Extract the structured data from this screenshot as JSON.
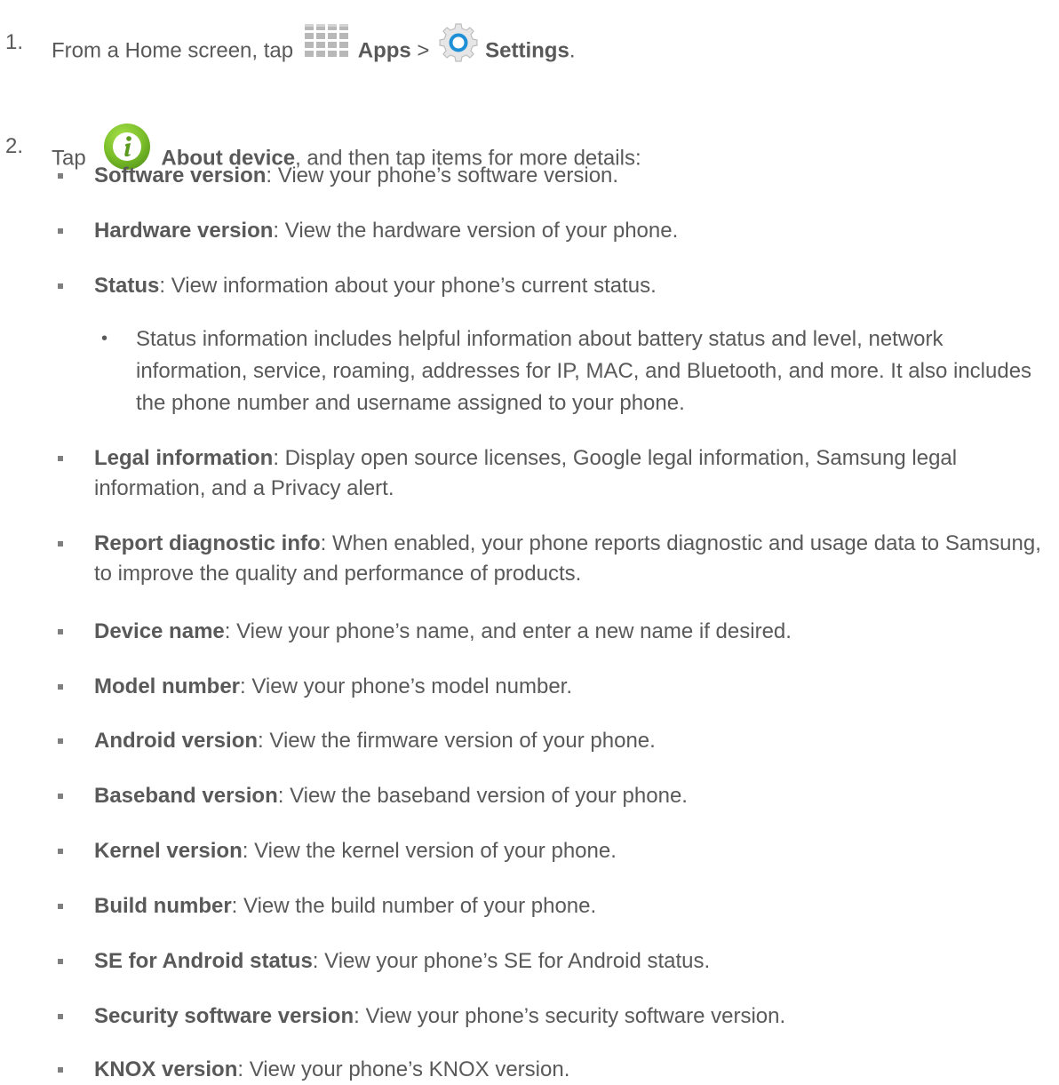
{
  "step1": {
    "number": "1.",
    "text_before": "From a Home screen, tap ",
    "apps_label": "Apps",
    "separator": " > ",
    "settings_label": "Settings",
    "text_after": ".",
    "apps_icon": "apps-grid-icon",
    "settings_icon": "settings-gear-icon"
  },
  "step2": {
    "number": "2.",
    "text_before": "Tap ",
    "about_label": "About device",
    "text_after": ", and then tap items for more details:",
    "about_icon": "info-circle-icon",
    "info_color": "#7bbf2a"
  },
  "items": [
    {
      "label": "Software version",
      "desc": ": View your phone’s software version."
    },
    {
      "label": "Hardware version",
      "desc": ": View the hardware version of your phone."
    },
    {
      "label": "Status",
      "desc": ": View information about your phone’s current status."
    },
    {
      "label": "Legal information",
      "desc": ": Display open source licenses, Google legal information, Samsung legal information, and a Privacy alert."
    },
    {
      "label": "Report diagnostic info",
      "desc": ": When enabled, your phone reports diagnostic and usage data to Samsung, to improve the quality and performance of products."
    },
    {
      "label": "Device name",
      "desc": ": View your phone’s name, and enter a new name if desired."
    },
    {
      "label": "Model number",
      "desc": ": View your phone’s model number."
    },
    {
      "label": "Android version",
      "desc": ": View the firmware version of your phone."
    },
    {
      "label": "Baseband version",
      "desc": ": View the baseband version of your phone."
    },
    {
      "label": "Kernel version",
      "desc": ": View the kernel version of your phone."
    },
    {
      "label": "Build number",
      "desc": ": View the build number of your phone."
    },
    {
      "label": "SE for Android status",
      "desc": ": View your phone’s SE for Android status."
    },
    {
      "label": "Security software version",
      "desc": ": View your phone’s security software version."
    },
    {
      "label": "KNOX version",
      "desc": ": View your phone’s KNOX version."
    }
  ],
  "status_note": {
    "marker": "•",
    "text": "Status information includes helpful information about battery status and level, network information, service, roaming, addresses for IP, MAC, and Bluetooth, and more. It also includes the phone number and username assigned to your phone."
  }
}
